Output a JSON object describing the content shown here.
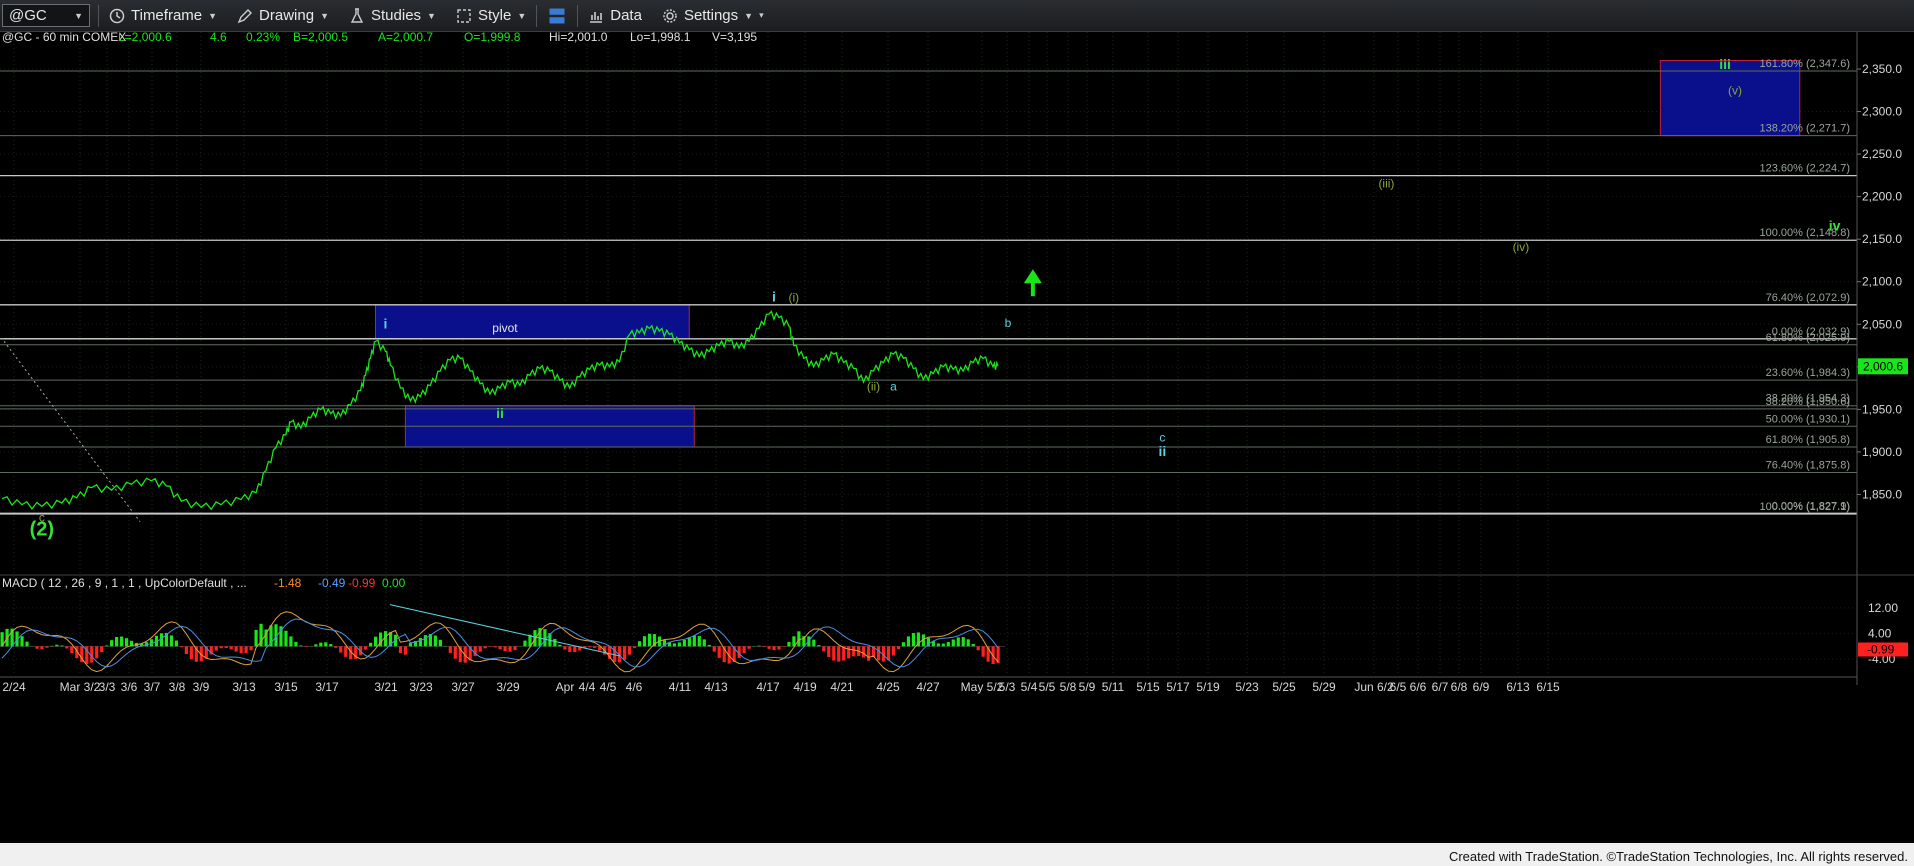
{
  "toolbar": {
    "symbol": "@GC",
    "timeframe_label": "Timeframe",
    "drawing_label": "Drawing",
    "studies_label": "Studies",
    "style_label": "Style",
    "data_label": "Data",
    "settings_label": "Settings"
  },
  "header": {
    "instrument": "@GC - 60 min  COMEX",
    "last": "L=2,000.6",
    "change": "4.6",
    "change_pct": "0.23%",
    "bid": "B=2,000.5",
    "ask": "A=2,000.7",
    "open": "O=1,999.8",
    "high": "Hi=2,001.0",
    "low": "Lo=1,998.1",
    "volume": "V=3,195"
  },
  "footer": "Created with TradeStation. ©TradeStation Technologies, Inc. All rights reserved.",
  "colors": {
    "price": "#19e619",
    "background": "#000000",
    "box_fill": "#0a0f8c",
    "box_border": "#c0203a",
    "fib_line": "#7a7a7a",
    "label_cyan": "#5ad3e0",
    "label_green": "#35e035",
    "label_olive": "#8aa63a",
    "macd_pos": "#19e619",
    "macd_neg": "#ff2020"
  },
  "chart_data": {
    "type": "line",
    "title": "@GC - 60 min  COMEX",
    "ylim": [
      1800,
      2370
    ],
    "y_ticks": [
      "2,350.0",
      "2,300.0",
      "2,250.0",
      "2,200.0",
      "2,150.0",
      "2,100.0",
      "2,050.0",
      "2,000.0",
      "1,950.0",
      "1,900.0",
      "1,850.0"
    ],
    "y_tick_values": [
      2350,
      2300,
      2250,
      2200,
      2150,
      2100,
      2050,
      2000,
      1950,
      1900,
      1850
    ],
    "last_price_label": "2,000.6",
    "last_price": 2000.6,
    "x_ticks": [
      "2/24",
      "Mar 3/2",
      "3/3",
      "3/6",
      "3/7",
      "3/8",
      "3/9",
      "3/13",
      "3/15",
      "3/17",
      "3/21",
      "3/23",
      "3/27",
      "3/29",
      "Apr",
      "4/4",
      "4/5",
      "4/6",
      "4/11",
      "4/13",
      "4/17",
      "4/19",
      "4/21",
      "4/25",
      "4/27",
      "May 5/2",
      "5/3",
      "5/4",
      "5/5",
      "5/8",
      "5/9",
      "5/11",
      "5/15",
      "5/17",
      "5/19",
      "5/23",
      "5/25",
      "5/29",
      "Jun 6/2",
      "6/5",
      "6/6",
      "6/7",
      "6/8",
      "6/9",
      "6/13",
      "6/15"
    ],
    "price_series": {
      "name": "@GC",
      "points": [
        [
          0,
          1845
        ],
        [
          4,
          1838
        ],
        [
          8,
          1836
        ],
        [
          12,
          1840
        ],
        [
          15,
          1846
        ],
        [
          18,
          1858
        ],
        [
          22,
          1855
        ],
        [
          26,
          1862
        ],
        [
          30,
          1866
        ],
        [
          33,
          1860
        ],
        [
          36,
          1842
        ],
        [
          40,
          1835
        ],
        [
          44,
          1838
        ],
        [
          48,
          1844
        ],
        [
          51,
          1852
        ],
        [
          53,
          1878
        ],
        [
          55,
          1905
        ],
        [
          57,
          1920
        ],
        [
          58,
          1935
        ],
        [
          60,
          1928
        ],
        [
          62,
          1940
        ],
        [
          64,
          1950
        ],
        [
          66,
          1945
        ],
        [
          68,
          1942
        ],
        [
          70,
          1955
        ],
        [
          72,
          1972
        ],
        [
          73,
          1990
        ],
        [
          74,
          2010
        ],
        [
          75,
          2030
        ],
        [
          77,
          2018
        ],
        [
          78,
          2002
        ],
        [
          80,
          1975
        ],
        [
          82,
          1960
        ],
        [
          84,
          1965
        ],
        [
          86,
          1978
        ],
        [
          88,
          1995
        ],
        [
          90,
          2008
        ],
        [
          92,
          2010
        ],
        [
          94,
          1995
        ],
        [
          96,
          1980
        ],
        [
          98,
          1968
        ],
        [
          100,
          1975
        ],
        [
          102,
          1982
        ],
        [
          104,
          1978
        ],
        [
          106,
          1990
        ],
        [
          108,
          1998
        ],
        [
          110,
          1995
        ],
        [
          112,
          1984
        ],
        [
          114,
          1975
        ],
        [
          116,
          1988
        ],
        [
          118,
          1997
        ],
        [
          120,
          2002
        ],
        [
          122,
          2000
        ],
        [
          124,
          2006
        ],
        [
          126,
          2038
        ],
        [
          128,
          2040
        ],
        [
          130,
          2045
        ],
        [
          132,
          2042
        ],
        [
          134,
          2038
        ],
        [
          136,
          2028
        ],
        [
          138,
          2020
        ],
        [
          140,
          2012
        ],
        [
          142,
          2018
        ],
        [
          144,
          2025
        ],
        [
          146,
          2030
        ],
        [
          148,
          2022
        ],
        [
          150,
          2030
        ],
        [
          152,
          2045
        ],
        [
          154,
          2062
        ],
        [
          156,
          2058
        ],
        [
          158,
          2048
        ],
        [
          159,
          2025
        ],
        [
          161,
          2010
        ],
        [
          163,
          2000
        ],
        [
          165,
          2008
        ],
        [
          167,
          2015
        ],
        [
          169,
          2005
        ],
        [
          171,
          1998
        ],
        [
          173,
          1982
        ],
        [
          175,
          1995
        ],
        [
          177,
          2005
        ],
        [
          179,
          2015
        ],
        [
          181,
          2010
        ],
        [
          183,
          1998
        ],
        [
          185,
          1985
        ],
        [
          187,
          1992
        ],
        [
          189,
          2000
        ],
        [
          191,
          1997
        ],
        [
          193,
          1995
        ],
        [
          195,
          2005
        ],
        [
          197,
          2010
        ],
        [
          199,
          2000
        ],
        [
          200,
          2001
        ]
      ]
    },
    "macd": {
      "label": "MACD ( 12 , 26 , 9 , 1 , 1 , UpColorDefault , ...",
      "values": [
        "-1.48",
        "-0.49",
        "-0.99",
        "0.00"
      ],
      "ylim": [
        -8,
        16
      ],
      "y_ticks": [
        "12.00",
        "4.00",
        "-4.00"
      ],
      "y_tick_values": [
        12,
        4,
        -4
      ],
      "current_label": "-0.99",
      "current": -0.99
    },
    "fib_levels": [
      {
        "label": "161.80% (2,347.6)",
        "value": 2347.6
      },
      {
        "label": "138.20% (2,271.7)",
        "value": 2271.7
      },
      {
        "label": "123.60% (2,224.7)",
        "value": 2224.7
      },
      {
        "label": "100.00% (2,148.8)",
        "value": 2148.8
      },
      {
        "label": "76.40% (2,072.9)",
        "value": 2072.9
      },
      {
        "label": "0.00% (2,032.9)",
        "value": 2032.9
      },
      {
        "label": "61.80% (2,025.9)",
        "value": 2025.9
      },
      {
        "label": "23.60% (1,984.3)",
        "value": 1984.3
      },
      {
        "label": "38.20% (1,954.3)",
        "value": 1954.3
      },
      {
        "label": "38.20% (1,950.6)",
        "value": 1950.6
      },
      {
        "label": "50.00% (1,930.1)",
        "value": 1930.1
      },
      {
        "label": "61.80% (1,905.8)",
        "value": 1905.8
      },
      {
        "label": "76.40% (1,875.8)",
        "value": 1875.8
      },
      {
        "label": "100.00% (1,827.1)",
        "value": 1827.1
      },
      {
        "label": "0.00% (1,827.9)",
        "value": 1827.9
      }
    ],
    "boxes": [
      {
        "name": "pivot",
        "y_top": 2072.9,
        "y_bottom": 2032.9,
        "x_start": 75,
        "x_end": 138
      },
      {
        "name": "ii",
        "y_top": 1954.3,
        "y_bottom": 1905.8,
        "x_start": 81,
        "x_end": 139
      },
      {
        "name": "target",
        "y_top": 2360,
        "y_bottom": 2271.7,
        "x_start": 333,
        "x_end": 361
      }
    ],
    "wave_labels": [
      {
        "text": "c",
        "x": 8,
        "y": 1818,
        "color": "olive"
      },
      {
        "text": "(2)",
        "x": 8,
        "y": 1802,
        "color": "green"
      },
      {
        "text": "i",
        "x": 77,
        "y": 2045,
        "color": "cyan"
      },
      {
        "text": "pivot",
        "x": 101,
        "y": 2041,
        "color": "white"
      },
      {
        "text": "ii",
        "x": 100,
        "y": 1940,
        "color": "green"
      },
      {
        "text": "i",
        "x": 155,
        "y": 2077,
        "color": "cyan"
      },
      {
        "text": "(i)",
        "x": 159,
        "y": 2077,
        "color": "olive"
      },
      {
        "text": "(ii)",
        "x": 175,
        "y": 1972,
        "color": "olive"
      },
      {
        "text": "a",
        "x": 179,
        "y": 1972,
        "color": "cyan"
      },
      {
        "text": "b",
        "x": 202,
        "y": 2047,
        "color": "cyan"
      },
      {
        "text": "c",
        "x": 233,
        "y": 1912,
        "color": "cyan"
      },
      {
        "text": "ii",
        "x": 233,
        "y": 1895,
        "color": "cyan"
      },
      {
        "text": "(iii)",
        "x": 278,
        "y": 2211,
        "color": "olive"
      },
      {
        "text": "(iv)",
        "x": 305,
        "y": 2136,
        "color": "olive"
      },
      {
        "text": "iv",
        "x": 368,
        "y": 2160,
        "color": "green"
      },
      {
        "text": "iii",
        "x": 346,
        "y": 2350,
        "color": "green"
      },
      {
        "text": "(v)",
        "x": 348,
        "y": 2320,
        "color": "olive"
      }
    ],
    "arrow": {
      "direction": "up",
      "x": 207,
      "y_from": 2083,
      "y_to": 2110
    }
  }
}
